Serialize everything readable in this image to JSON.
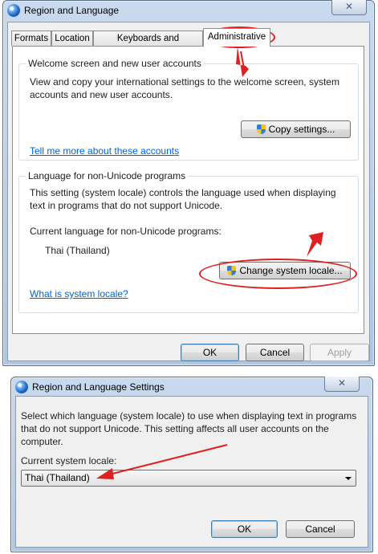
{
  "dialog1": {
    "title": "Region and Language",
    "close_glyph": "✕",
    "tabs": [
      {
        "label": "Formats"
      },
      {
        "label": "Location"
      },
      {
        "label": "Keyboards and Languages"
      },
      {
        "label": "Administrative",
        "active": true
      }
    ],
    "welcome_group": {
      "title": "Welcome screen and new user accounts",
      "description": "View and copy your international settings to the welcome screen, system accounts and new user accounts.",
      "copy_button": "Copy settings...",
      "link": "Tell me more about these accounts"
    },
    "nonunicode_group": {
      "title": "Language for non-Unicode programs",
      "description": "This setting (system locale) controls the language used when displaying text in programs that do not support Unicode.",
      "current_label": "Current language for non-Unicode programs:",
      "current_value": "Thai (Thailand)",
      "change_button": "Change system locale...",
      "link": "What is system locale?"
    },
    "buttons": {
      "ok": "OK",
      "cancel": "Cancel",
      "apply": "Apply"
    }
  },
  "dialog2": {
    "title": "Region and Language Settings",
    "close_glyph": "✕",
    "description": "Select which language (system locale) to use when displaying text in programs that do not support Unicode. This setting affects all user accounts on the computer.",
    "locale_label": "Current system locale:",
    "locale_value": "Thai (Thailand)",
    "buttons": {
      "ok": "OK",
      "cancel": "Cancel"
    }
  },
  "colors": {
    "annotation": "#e02020",
    "link": "#0066cc",
    "window_frame": "#c9daee"
  }
}
